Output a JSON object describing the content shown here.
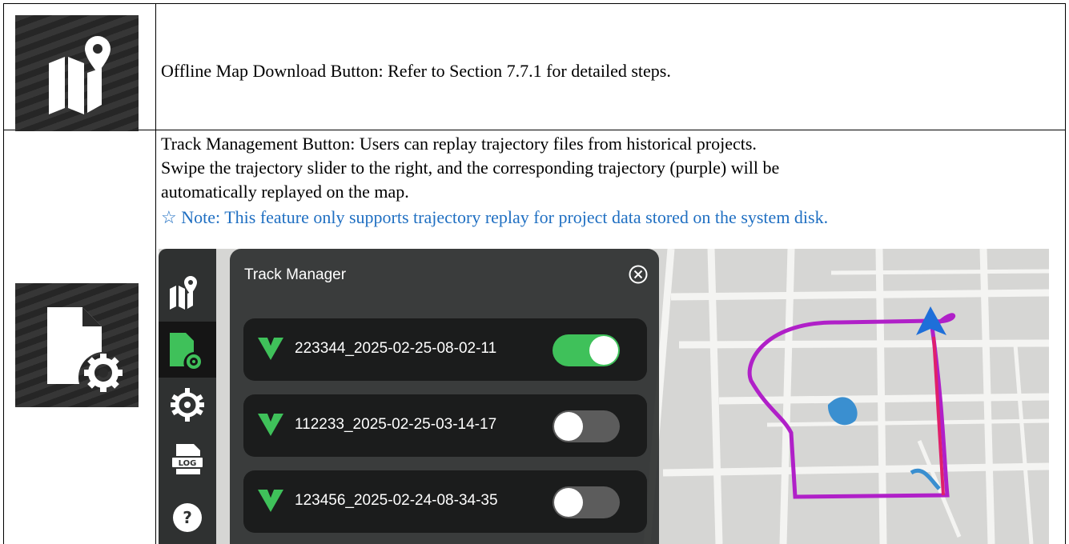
{
  "row1": {
    "icon": "offline-map-icon",
    "description": "Offline Map Download Button: Refer to Section 7.7.1 for detailed steps."
  },
  "row2": {
    "icon": "track-management-icon",
    "line1": "Track Management Button: Users can replay trajectory files from historical projects.",
    "line2": "Swipe the trajectory slider to the right, and the corresponding trajectory (purple) will be",
    "line3": "automatically replayed on the map.",
    "note": "☆ Note: This feature only supports trajectory replay for project data stored on the system disk."
  },
  "screenshot": {
    "sidebar_icons": [
      "map-pin-icon",
      "track-file-gear-icon",
      "settings-gear-icon",
      "log-icon",
      "help-icon"
    ],
    "sidebar_log_label": "LOG",
    "sidebar_help_label": "?",
    "panel_title": "Track Manager",
    "tracks": [
      {
        "name": "223344_2025-02-25-08-02-11",
        "enabled": true
      },
      {
        "name": "112233_2025-02-25-03-14-17",
        "enabled": false
      },
      {
        "name": "123456_2025-02-24-08-34-35",
        "enabled": false
      }
    ],
    "colors": {
      "toggle_on": "#3fc15a",
      "trajectory": "#b020c8",
      "arrow": "#1e6fd9"
    }
  }
}
